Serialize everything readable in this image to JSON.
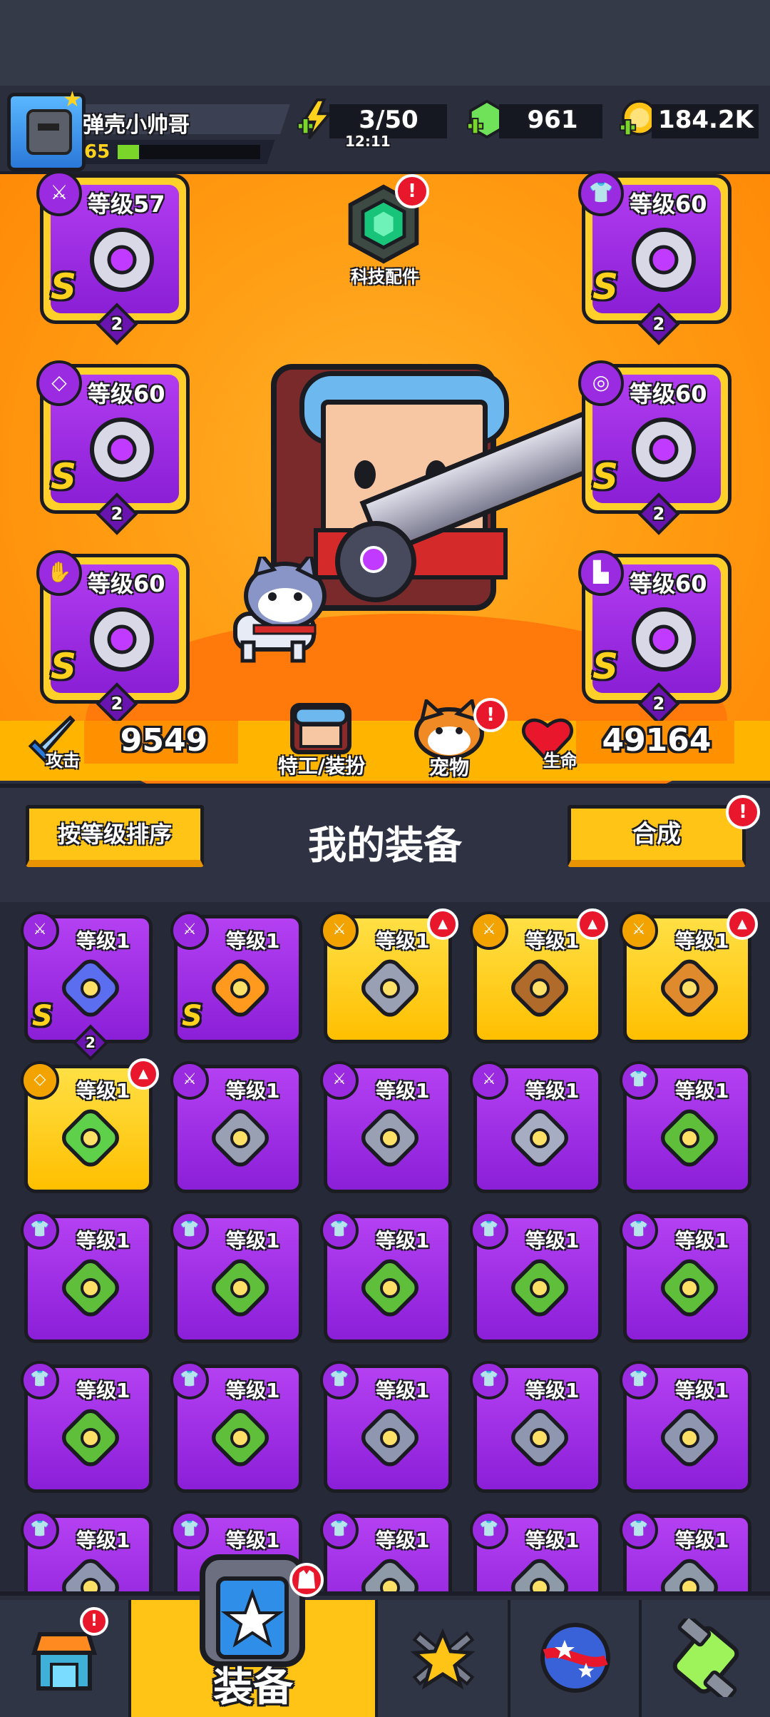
{
  "player": {
    "name": "弹壳小帅哥",
    "level": "65",
    "xp_fraction": 0.15
  },
  "resources": {
    "energy": "3/50",
    "energy_timer": "12:11",
    "gems": "961",
    "coins": "184.2K"
  },
  "tech": {
    "label": "科技配件",
    "badge": "!"
  },
  "equipped": [
    {
      "id": "weapon",
      "level": "等级57",
      "grade": "S",
      "stars": "2",
      "type_icon": "weapon-icon"
    },
    {
      "id": "armor",
      "level": "等级60",
      "grade": "S",
      "stars": "2",
      "type_icon": "armor-icon"
    },
    {
      "id": "necklace",
      "level": "等级60",
      "grade": "S",
      "stars": "2",
      "type_icon": "necklace-icon"
    },
    {
      "id": "belt",
      "level": "等级60",
      "grade": "S",
      "stars": "2",
      "type_icon": "belt-icon"
    },
    {
      "id": "gloves",
      "level": "等级60",
      "grade": "S",
      "stars": "2",
      "type_icon": "gloves-icon"
    },
    {
      "id": "boots",
      "level": "等级60",
      "grade": "S",
      "stars": "2",
      "type_icon": "boots-icon"
    }
  ],
  "stats": {
    "attack_label": "攻击",
    "attack": "9549",
    "hp_label": "生命",
    "hp": "49164"
  },
  "buttons": {
    "agent": "特工/装扮",
    "pet": "宠物",
    "pet_badge": "!",
    "sort": "按等级排序",
    "merge": "合成",
    "merge_badge": "!"
  },
  "section_title": "我的装备",
  "inventory": [
    {
      "level": "等级1",
      "bg": "purple",
      "type": "weapon",
      "item": "blaster-icon",
      "grade": "S",
      "stars": "2",
      "new": false
    },
    {
      "level": "等级1",
      "bg": "purple",
      "type": "weapon",
      "item": "flame-sword-icon",
      "grade": "S",
      "new": false
    },
    {
      "level": "等级1",
      "bg": "yellow",
      "type": "weapon",
      "item": "kunai-icon",
      "new": true
    },
    {
      "level": "等级1",
      "bg": "yellow",
      "type": "weapon",
      "item": "shotgun-icon",
      "new": true
    },
    {
      "level": "等级1",
      "bg": "yellow",
      "type": "weapon",
      "item": "bat-icon",
      "new": true
    },
    {
      "level": "等级1",
      "bg": "yellow",
      "type": "necklace",
      "item": "ring-icon",
      "new": true
    },
    {
      "level": "等级1",
      "bg": "purple",
      "type": "weapon",
      "item": "kunai-icon",
      "new": false
    },
    {
      "level": "等级1",
      "bg": "purple",
      "type": "weapon",
      "item": "kunai-icon",
      "new": false
    },
    {
      "level": "等级1",
      "bg": "purple",
      "type": "weapon",
      "item": "revolver-icon",
      "new": false
    },
    {
      "level": "等级1",
      "bg": "purple",
      "type": "armor",
      "item": "leaf-armor-icon",
      "new": false
    },
    {
      "level": "等级1",
      "bg": "purple",
      "type": "armor",
      "item": "leaf-armor-icon",
      "new": false
    },
    {
      "level": "等级1",
      "bg": "purple",
      "type": "armor",
      "item": "leaf-armor-icon",
      "new": false
    },
    {
      "level": "等级1",
      "bg": "purple",
      "type": "armor",
      "item": "leaf-armor-icon",
      "new": false
    },
    {
      "level": "等级1",
      "bg": "purple",
      "type": "armor",
      "item": "leaf-armor-icon",
      "new": false
    },
    {
      "level": "等级1",
      "bg": "purple",
      "type": "armor",
      "item": "leaf-armor-icon",
      "new": false
    },
    {
      "level": "等级1",
      "bg": "purple",
      "type": "armor",
      "item": "leaf-armor-icon",
      "new": false
    },
    {
      "level": "等级1",
      "bg": "purple",
      "type": "armor",
      "item": "leaf-armor-icon",
      "new": false
    },
    {
      "level": "等级1",
      "bg": "purple",
      "type": "armor",
      "item": "steel-armor-icon",
      "new": false
    },
    {
      "level": "等级1",
      "bg": "purple",
      "type": "armor",
      "item": "steel-armor-icon",
      "new": false
    },
    {
      "level": "等级1",
      "bg": "purple",
      "type": "armor",
      "item": "steel-armor-icon",
      "new": false
    },
    {
      "level": "等级1",
      "bg": "purple",
      "type": "armor",
      "item": "steel-armor-icon",
      "new": false
    },
    {
      "level": "等级1",
      "bg": "purple",
      "type": "armor",
      "item": "steel-armor-icon",
      "new": false
    },
    {
      "level": "等级1",
      "bg": "purple",
      "type": "armor",
      "item": "gem-armor-icon",
      "new": false
    },
    {
      "level": "等级1",
      "bg": "purple",
      "type": "armor",
      "item": "gem-armor-icon",
      "new": false
    },
    {
      "level": "等级1",
      "bg": "purple",
      "type": "armor",
      "item": "gem-armor-icon",
      "new": false
    }
  ],
  "nav": [
    {
      "id": "shop",
      "label": "",
      "icon": "shop-icon",
      "badge": "!"
    },
    {
      "id": "equipment",
      "label": "装备",
      "icon": "equipment-icon",
      "active": true
    },
    {
      "id": "battle",
      "label": "",
      "icon": "battle-icon"
    },
    {
      "id": "evolution",
      "label": "",
      "icon": "planet-icon"
    },
    {
      "id": "gene",
      "label": "",
      "icon": "dna-icon"
    }
  ],
  "colors": {
    "accent": "#ffc415",
    "purple": "#9a2be0",
    "orange": "#ff9c12",
    "badge": "#e8172b"
  }
}
